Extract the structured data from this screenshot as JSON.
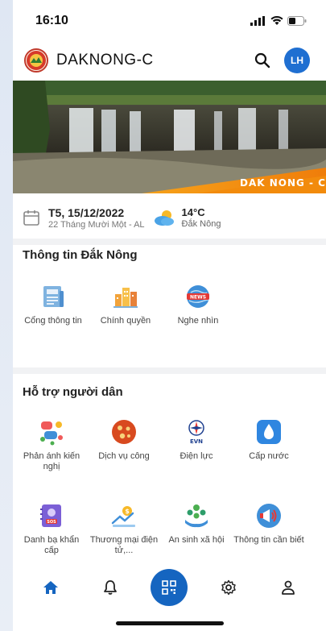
{
  "status_bar": {
    "time": "16:10"
  },
  "header": {
    "title": "DAKNONG-C",
    "avatar_initials": "LH"
  },
  "banner": {
    "caption": "DAK NONG - C"
  },
  "info_row": {
    "date_main": "T5, 15/12/2022",
    "date_sub": "22 Tháng Mười Một - AL",
    "temperature": "14°C",
    "location": "Đắk Nông"
  },
  "section_info": {
    "title": "Thông tin Đắk Nông",
    "items": [
      {
        "label": "Cổng thông tin",
        "icon": "newspaper-icon"
      },
      {
        "label": "Chính quyền",
        "icon": "city-building-icon"
      },
      {
        "label": "Nghe nhìn",
        "icon": "news-globe-icon"
      }
    ]
  },
  "section_support": {
    "title": "Hỗ trợ người dân",
    "items": [
      {
        "label": "Phản ánh kiến nghị",
        "icon": "feedback-icon"
      },
      {
        "label": "Dịch vụ công",
        "icon": "public-service-icon"
      },
      {
        "label": "Điện lực",
        "icon": "evn-electric-icon"
      },
      {
        "label": "Cấp nước",
        "icon": "water-drop-icon"
      },
      {
        "label": "Danh bạ khẩn cấp",
        "icon": "sos-phonebook-icon"
      },
      {
        "label": "Thương mại điện tử,...",
        "icon": "ecommerce-icon"
      },
      {
        "label": "An sinh xã hội",
        "icon": "social-welfare-icon"
      },
      {
        "label": "Thông tin cần biết",
        "icon": "megaphone-icon"
      }
    ]
  },
  "colors": {
    "primary": "#1565c0",
    "avatar": "#1f6fd1",
    "divider": "#f1f2f4"
  }
}
